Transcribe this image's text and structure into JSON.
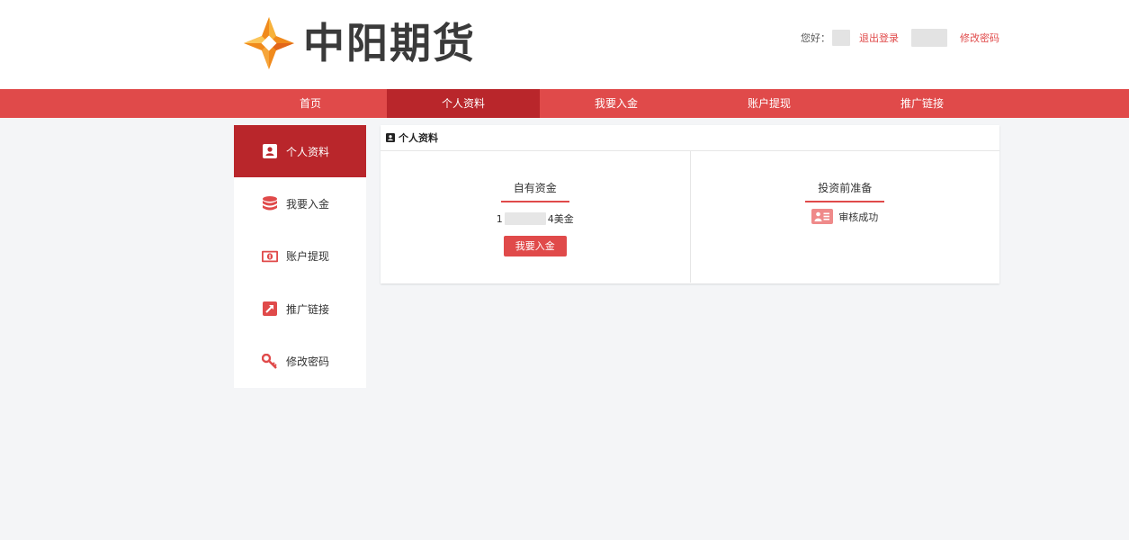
{
  "brand": {
    "name": "中阳期货",
    "accent": "#e04a4a",
    "active": "#b9262b",
    "logo_icon": "four-point-star-logo-icon"
  },
  "userbar": {
    "greeting": "您好：",
    "logout": "退出登录",
    "change_password": "修改密码"
  },
  "nav": {
    "items": [
      {
        "label": "首页",
        "active": false
      },
      {
        "label": "个人资料",
        "active": true
      },
      {
        "label": "我要入金",
        "active": false
      },
      {
        "label": "账户提现",
        "active": false
      },
      {
        "label": "推广链接",
        "active": false
      }
    ]
  },
  "sidebar": {
    "items": [
      {
        "label": "个人资料",
        "icon": "user-card-icon",
        "active": true
      },
      {
        "label": "我要入金",
        "icon": "database-coins-icon",
        "active": false
      },
      {
        "label": "账户提现",
        "icon": "money-bill-icon",
        "active": false
      },
      {
        "label": "推广链接",
        "icon": "external-link-icon",
        "active": false
      },
      {
        "label": "修改密码",
        "icon": "key-icon",
        "active": false
      }
    ]
  },
  "panel": {
    "title": "个人资料",
    "funds": {
      "title": "自有资金",
      "amount_prefix": "1",
      "amount_suffix": "4美金",
      "button": "我要入金"
    },
    "prep": {
      "title": "投资前准备",
      "status": "审核成功",
      "status_icon": "id-card-icon"
    }
  }
}
